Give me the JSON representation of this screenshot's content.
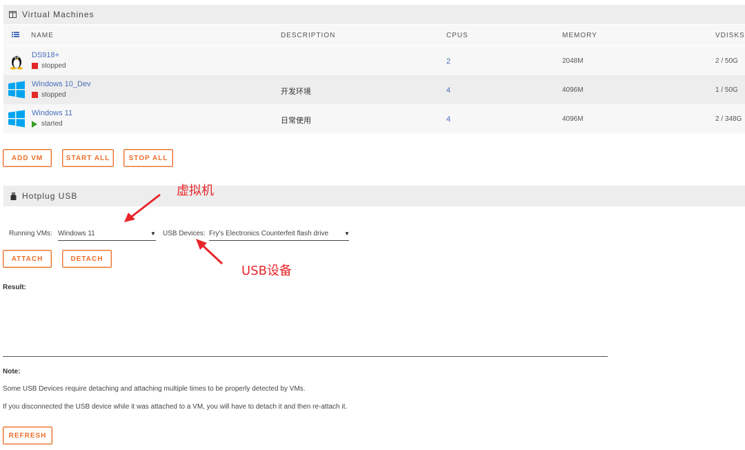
{
  "vm_section": {
    "title": "Virtual Machines",
    "columns": [
      "NAME",
      "DESCRIPTION",
      "CPUS",
      "MEMORY",
      "VDISKS"
    ],
    "rows": [
      {
        "name": "DS918+",
        "status": "stopped",
        "description": "",
        "cpus": "2",
        "memory": "2048M",
        "vdisks": "2 / 50G",
        "os_icon": "linux-tux-icon"
      },
      {
        "name": "Windows 10_Dev",
        "status": "stopped",
        "description": "开发环境",
        "cpus": "4",
        "memory": "4096M",
        "vdisks": "1 / 50G",
        "os_icon": "windows-icon"
      },
      {
        "name": "Windows 11",
        "status": "started",
        "description": "日常使用",
        "cpus": "4",
        "memory": "4096M",
        "vdisks": "2 / 348G",
        "os_icon": "windows-icon"
      }
    ],
    "buttons": {
      "add_vm": "ADD VM",
      "start_all": "START ALL",
      "stop_all": "STOP ALL"
    }
  },
  "usb_section": {
    "title": "Hotplug USB",
    "running_vms_label": "Running VMs:",
    "running_vms_value": "Windows 11",
    "usb_devices_label": "USB Devices:",
    "usb_devices_value": "Fry's Electronics Counterfeit flash drive",
    "buttons": {
      "attach": "ATTACH",
      "detach": "DETACH",
      "refresh": "REFRESH"
    },
    "result_label": "Result:",
    "note_label": "Note:",
    "note_line1": "Some USB Devices require detaching and attaching multiple times to be properly detected by VMs.",
    "note_line2": "If you disconnected the USB device while it was attached to a VM, you will have to detach it and then re-attach it."
  },
  "annotations": {
    "vm_annotation": "虚拟机",
    "usb_annotation": "USB设备",
    "color": "#e8262a"
  },
  "colors": {
    "accent": "#ec6f29",
    "link": "#486dba",
    "stopped": "#e22828",
    "started": "#3a9d23",
    "windows_blue": "#00a4ef"
  }
}
